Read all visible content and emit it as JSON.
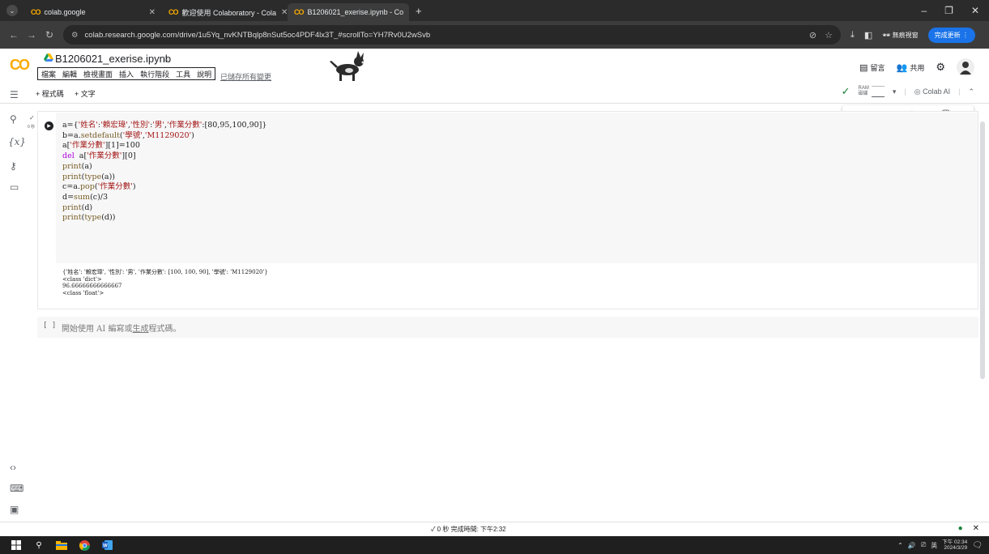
{
  "browser": {
    "tabs": [
      {
        "label": "colab.google",
        "close": "✕"
      },
      {
        "label": "歡迎使用 Colaboratory - Cola",
        "close": "✕"
      },
      {
        "label": "B1206021_exerise.ipynb - Co",
        "close": "✕"
      }
    ],
    "new_tab": "+",
    "window_controls": [
      "–",
      "❐",
      "✕"
    ],
    "url": "colab.research.google.com/drive/1u5Yq_nvKNTBqlp8nSut5oc4PDF4lx3T_#scrollTo=YH7Rv0U2wSvb",
    "incognito_label": "無痕視窗",
    "update_label": "完成更新 ⋮"
  },
  "colab": {
    "logo": "CO",
    "notebook_title": "B1206021_exerise.ipynb",
    "menu": [
      "檔案",
      "編輯",
      "檢視畫面",
      "插入",
      "執行階段",
      "工具",
      "說明"
    ],
    "saved_status": "已儲存所有變更",
    "header_right": {
      "comment": "留言",
      "share": "共用"
    },
    "toolbar": {
      "add_code": "+ 程式碼",
      "add_text": "+ 文字"
    },
    "ram_label": "RAM",
    "disk_label": "磁碟",
    "colab_ai": "Colab AI"
  },
  "cell": {
    "exec_time": "0 秒",
    "code_lines": [
      "a={'姓名':'賴宏瑋','性別':'男','作業分數':[80,95,100,90]}",
      "b=a.setdefault('學號','M1129020')",
      "a['作業分數'][1]=100",
      "del  a['作業分數'][0]",
      "print(a)",
      "print(type(a))",
      "c=a.pop('作業分數')",
      "d=sum(c)/3",
      "print(d)",
      "print(type(d))"
    ],
    "output_lines": [
      "{'姓名': '賴宏瑋', '性別': '男', '作業分數': [100, 100, 90], '學號': 'M1129020'}",
      "<class 'dict'>",
      "96.66666666666667",
      "<class 'float'>"
    ]
  },
  "empty_cell": {
    "bracket": "[ ]",
    "hint_prefix": "開始使用 AI 編寫或",
    "hint_link": "生成",
    "hint_suffix": "程式碼。"
  },
  "status": {
    "text": "✓ 0 秒   完成時間: 下午2:32"
  },
  "taskbar": {
    "ime": "英",
    "time": "下午 02:34",
    "date": "2024/3/29"
  }
}
